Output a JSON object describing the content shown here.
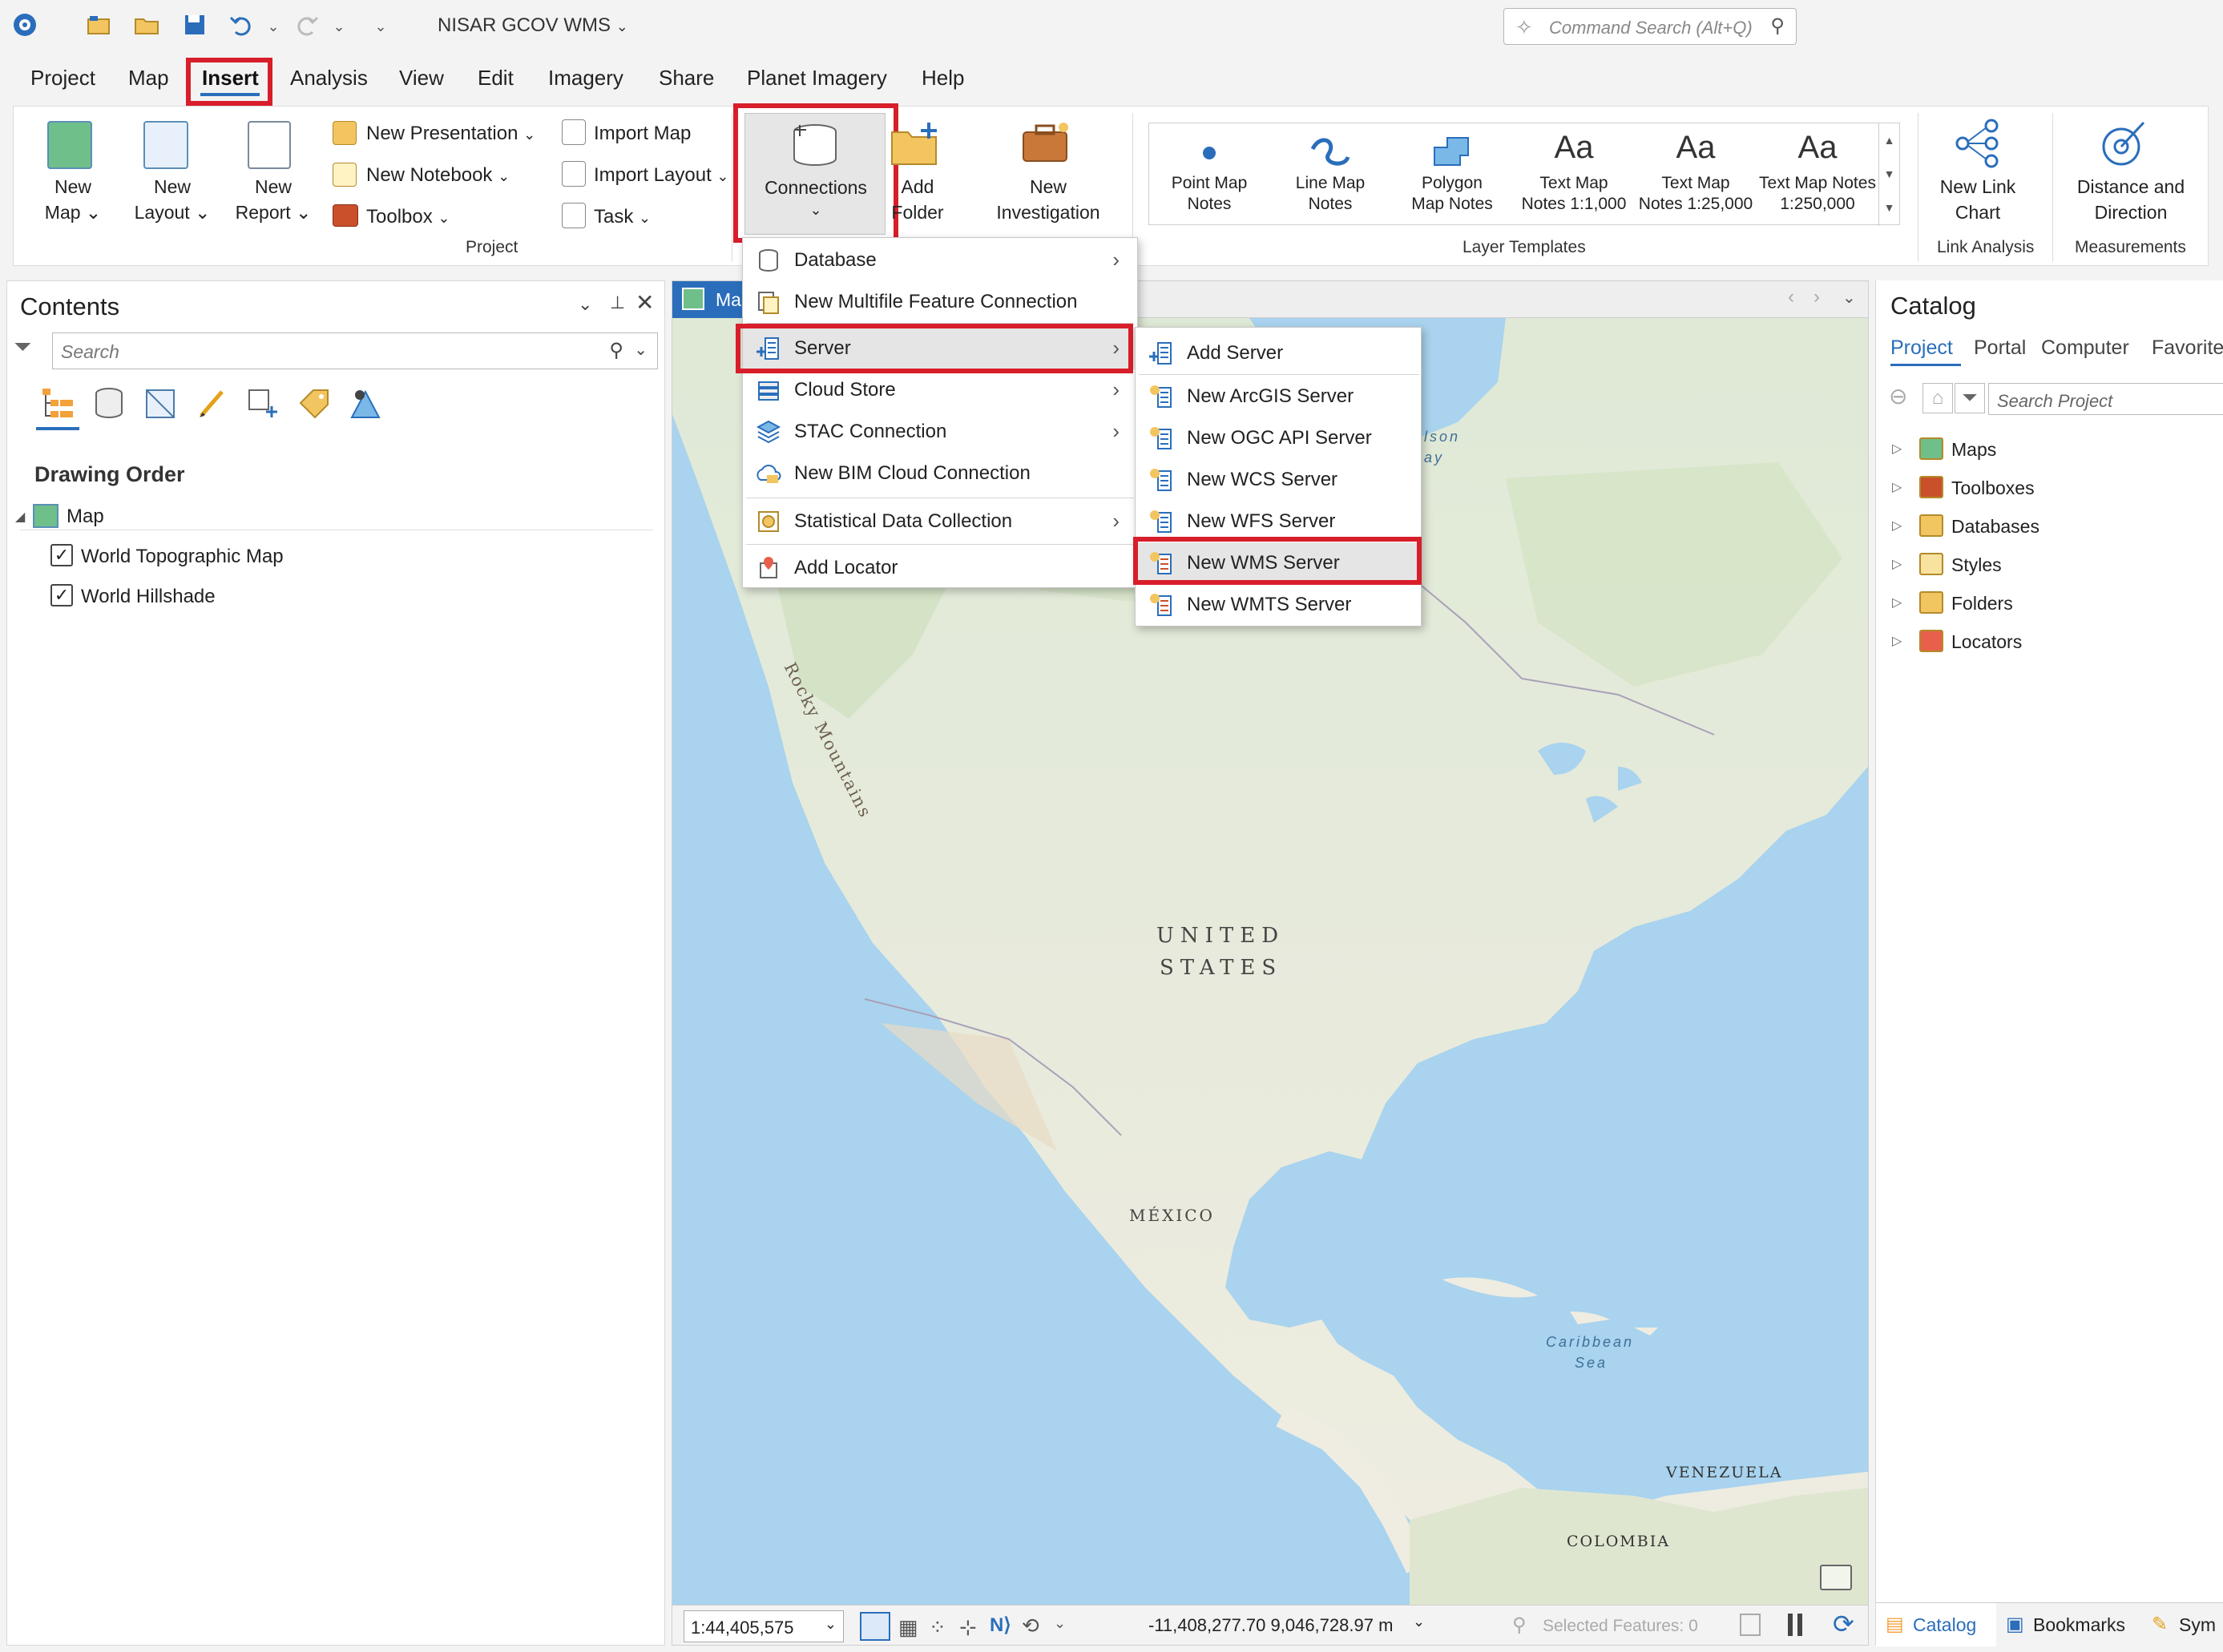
{
  "titlebar": {
    "project_title": "NISAR GCOV WMS",
    "command_search_placeholder": "Command Search (Alt+Q)"
  },
  "menu": {
    "tabs": [
      "Project",
      "Map",
      "Insert",
      "Analysis",
      "View",
      "Edit",
      "Imagery",
      "Share",
      "Planet Imagery",
      "Help"
    ],
    "active": "Insert"
  },
  "ribbon": {
    "new_map": "New\nMap",
    "new_layout": "New\nLayout",
    "new_report": "New\nReport",
    "new_presentation": "New Presentation",
    "new_notebook": "New Notebook",
    "toolbox": "Toolbox",
    "import_map": "Import Map",
    "import_layout": "Import Layout",
    "task": "Task",
    "connections": "Connections",
    "add_folder": "Add\nFolder",
    "new_investigation": "New\nInvestigation",
    "group_project": "Project",
    "layer_templates": [
      "Point Map\nNotes",
      "Line Map\nNotes",
      "Polygon\nMap Notes",
      "Text Map\nNotes 1:1,000",
      "Text Map\nNotes 1:25,000",
      "Text Map Notes\n1:250,000"
    ],
    "group_layer_templates": "Layer Templates",
    "new_link_chart": "New Link\nChart",
    "group_link_analysis": "Link Analysis",
    "distance_direction": "Distance and\nDirection",
    "group_measurements": "Measurements",
    "aa_glyph": "Aa"
  },
  "connections_menu": {
    "items": [
      {
        "label": "Database",
        "submenu": true
      },
      {
        "label": "New Multifile Feature Connection",
        "submenu": false
      },
      {
        "label": "Server",
        "submenu": true
      },
      {
        "label": "Cloud Store",
        "submenu": true
      },
      {
        "label": "STAC Connection",
        "submenu": true
      },
      {
        "label": "New BIM Cloud Connection",
        "submenu": false
      },
      {
        "label": "Statistical Data Collection",
        "submenu": true
      },
      {
        "label": "Add Locator",
        "submenu": false
      }
    ]
  },
  "server_menu": {
    "items": [
      "Add Server",
      "New ArcGIS Server",
      "New OGC API Server",
      "New WCS Server",
      "New WFS Server",
      "New WMS Server",
      "New WMTS Server"
    ],
    "highlighted": "New WMS Server"
  },
  "contents": {
    "title": "Contents",
    "search_placeholder": "Search",
    "drawing_order": "Drawing Order",
    "map_name": "Map",
    "layers": [
      {
        "name": "World Topographic Map",
        "checked": true
      },
      {
        "name": "World Hillshade",
        "checked": true
      }
    ]
  },
  "map": {
    "tab_label": "Ma",
    "labels": {
      "rocky": "Rocky Mountains",
      "us1": "UNITED",
      "us2": "STATES",
      "mexico": "MÉXICO",
      "caribbean1": "Caribbean",
      "caribbean2": "Sea",
      "venezuela": "VENEZUELA",
      "colombia": "COLOMBIA",
      "hudson1": "lson",
      "hudson2": "ay"
    },
    "scale": "1:44,405,575",
    "coordinates": "-11,408,277.70 9,046,728.97 m",
    "selected_features": "Selected Features: 0"
  },
  "catalog": {
    "title": "Catalog",
    "tabs": [
      "Project",
      "Portal",
      "Computer",
      "Favorite"
    ],
    "search_placeholder": "Search Project",
    "items": [
      "Maps",
      "Toolboxes",
      "Databases",
      "Styles",
      "Folders",
      "Locators"
    ],
    "bottom_tabs": [
      "Catalog",
      "Bookmarks",
      "Sym"
    ]
  },
  "colors": {
    "highlight_red": "#d81e2a",
    "accent_blue": "#2a6ebb",
    "water": "#a9d3ee",
    "land": "#f1efe6"
  }
}
